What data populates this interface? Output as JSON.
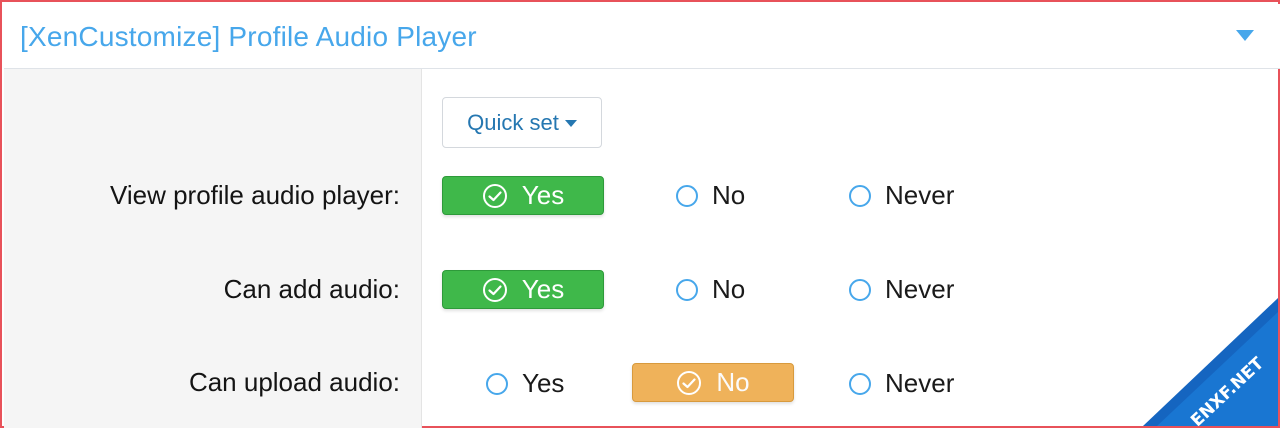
{
  "panel": {
    "title": "[XenCustomize] Profile Audio Player",
    "toggle_icon": "chevron-down-icon"
  },
  "quick_set": {
    "label": "Quick set"
  },
  "permissions": [
    {
      "label": "View profile audio player:",
      "options": [
        "Yes",
        "No",
        "Never"
      ],
      "selected": "Yes"
    },
    {
      "label": "Can add audio:",
      "options": [
        "Yes",
        "No",
        "Never"
      ],
      "selected": "Yes"
    },
    {
      "label": "Can upload audio:",
      "options": [
        "Yes",
        "No",
        "Never"
      ],
      "selected": "No"
    }
  ],
  "colors": {
    "accent": "#47a7eb",
    "yes_selected": "#3fb84a",
    "no_selected": "#efb25a",
    "frame_border": "#e8525a",
    "watermark": "#1565c0"
  },
  "watermark": {
    "text": "ENXF.NET"
  }
}
